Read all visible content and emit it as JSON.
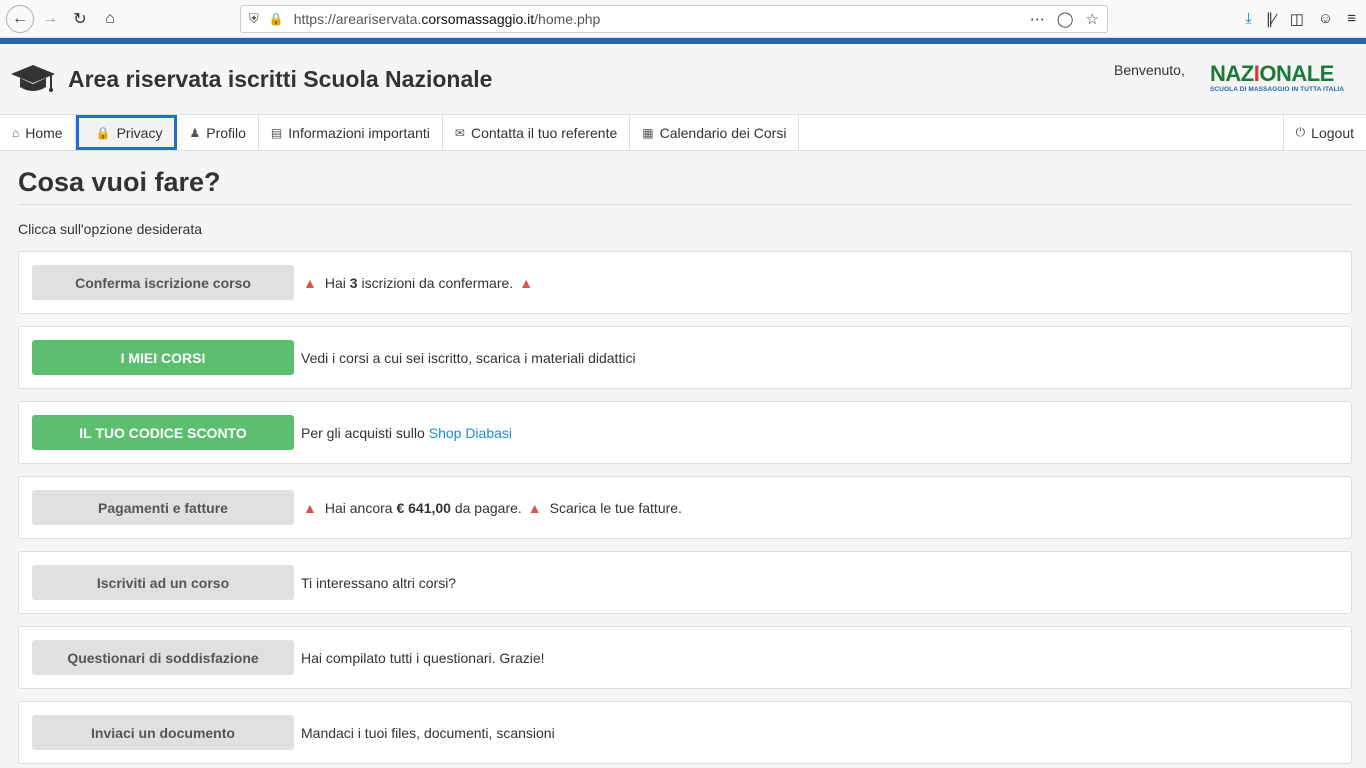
{
  "browser": {
    "url_prefix": "https://areariservata.",
    "url_domain": "corsomassaggio.it",
    "url_path": "/home.php"
  },
  "header": {
    "title": "Area riservata iscritti Scuola Nazionale",
    "welcome": "Benvenuto,",
    "logo_part1": "NAZ",
    "logo_part2": "I",
    "logo_part3": "ONALE",
    "logo_tagline": "SCUOLA DI MASSAGGIO IN TUTTA ITALIA"
  },
  "menu": {
    "home": "Home",
    "privacy": "Privacy",
    "profilo": "Profilo",
    "info": "Informazioni importanti",
    "referente": "Contatta il tuo referente",
    "calendario": "Calendario dei Corsi",
    "logout": "Logout"
  },
  "main": {
    "title": "Cosa vuoi fare?",
    "instructions": "Clicca sull'opzione desiderata",
    "options": [
      {
        "button": "Conferma iscrizione corso",
        "pre": "Hai",
        "bold": "3",
        "post": "iscrizioni da confermare."
      },
      {
        "button": "I MIEI CORSI",
        "desc": "Vedi i corsi a cui sei iscritto, scarica i materiali didattici"
      },
      {
        "button": "IL TUO CODICE SCONTO",
        "desc": "Per gli acquisti sullo",
        "link": "Shop Diabasi"
      },
      {
        "button": "Pagamenti e fatture",
        "pre": "Hai ancora",
        "bold": "€ 641,00",
        "post": "da pagare.",
        "extra": "Scarica le tue fatture."
      },
      {
        "button": "Iscriviti ad un corso",
        "desc": "Ti interessano altri corsi?"
      },
      {
        "button": "Questionari di soddisfazione",
        "desc": "Hai compilato tutti i questionari. Grazie!"
      },
      {
        "button": "Inviaci un documento",
        "desc": "Mandaci i tuoi files, documenti, scansioni"
      }
    ]
  },
  "colors": {
    "accent": "#1f67b1",
    "green": "#5cbf70",
    "warning": "#d9534f",
    "link": "#1a8fd0"
  }
}
